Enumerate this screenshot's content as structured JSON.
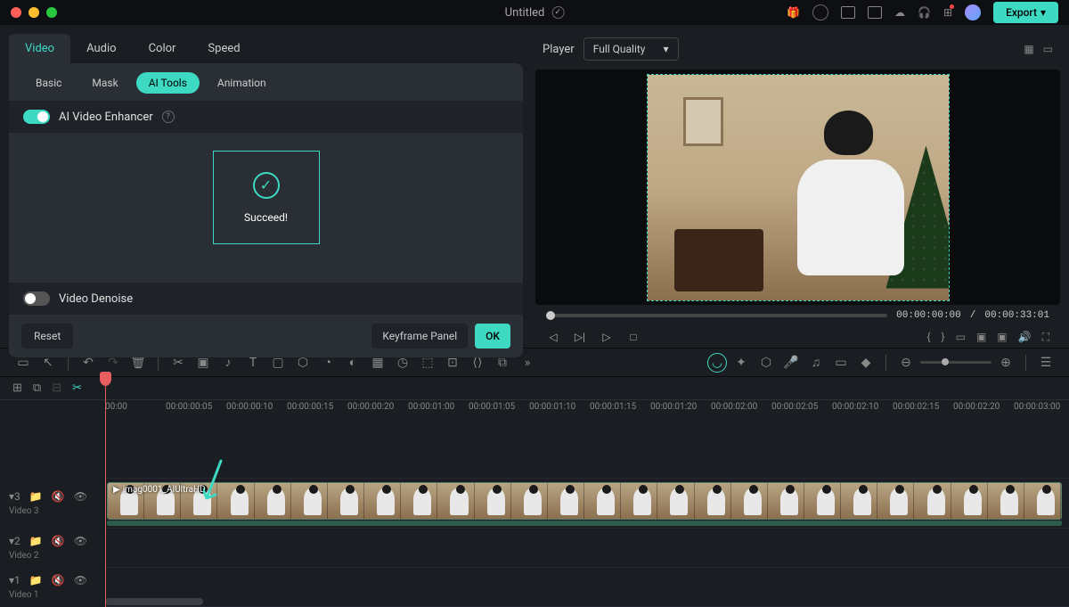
{
  "titlebar": {
    "title": "Untitled",
    "export": "Export"
  },
  "tabs1": {
    "video": "Video",
    "audio": "Audio",
    "color": "Color",
    "speed": "Speed"
  },
  "tabs2": {
    "basic": "Basic",
    "mask": "Mask",
    "aitools": "AI Tools",
    "animation": "Animation"
  },
  "enhancer": {
    "label": "AI Video Enhancer",
    "succeed": "Succeed!"
  },
  "denoise": {
    "label": "Video Denoise"
  },
  "buttons": {
    "reset": "Reset",
    "keyframe": "Keyframe Panel",
    "ok": "OK"
  },
  "player": {
    "label": "Player",
    "quality": "Full Quality",
    "current": "00:00:00:00",
    "total": "00:00:33:01"
  },
  "ruler": [
    "00:00",
    "00:00:00:05",
    "00:00:00:10",
    "00:00:00:15",
    "00:00:00:20",
    "00:00:01:00",
    "00:00:01:05",
    "00:00:01:10",
    "00:00:01:15",
    "00:00:01:20",
    "00:00:02:00",
    "00:00:02:05",
    "00:00:02:10",
    "00:00:02:15",
    "00:00:02:20",
    "00:00:03:00"
  ],
  "tracks": {
    "v3": {
      "icons": "▾3",
      "label": "Video 3",
      "clip": "imag0001_AIUltraHD"
    },
    "v2": {
      "icons": "▾2",
      "label": "Video 2"
    },
    "v1": {
      "icons": "▾1",
      "label": "Video 1"
    }
  }
}
